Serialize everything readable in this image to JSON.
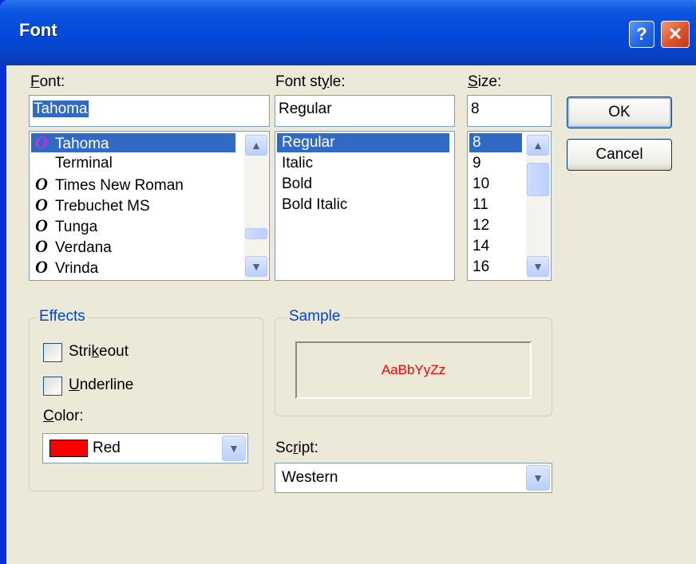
{
  "window": {
    "title": "Font",
    "help_glyph": "?",
    "close_glyph": "✕"
  },
  "font": {
    "label": "Font:",
    "label_mnemonic": "F",
    "label_rest": "ont:",
    "value": "Tahoma",
    "items": [
      {
        "name": "Tahoma",
        "icon": "O",
        "selected": true
      },
      {
        "name": "Terminal",
        "icon": "",
        "selected": false
      },
      {
        "name": "Times New Roman",
        "icon": "O",
        "selected": false
      },
      {
        "name": "Trebuchet MS",
        "icon": "O",
        "selected": false
      },
      {
        "name": "Tunga",
        "icon": "O",
        "selected": false
      },
      {
        "name": "Verdana",
        "icon": "O",
        "selected": false
      },
      {
        "name": "Vrinda",
        "icon": "O",
        "selected": false
      }
    ]
  },
  "style": {
    "label": "Font style:",
    "label_prefix": "Font st",
    "label_mnemonic": "y",
    "label_rest": "le:",
    "value": "Regular",
    "items": [
      "Regular",
      "Italic",
      "Bold",
      "Bold Italic"
    ],
    "selected_index": 0
  },
  "size": {
    "label": "Size:",
    "label_mnemonic": "S",
    "label_rest": "ize:",
    "value": "8",
    "items": [
      "8",
      "9",
      "10",
      "11",
      "12",
      "14",
      "16"
    ],
    "selected_index": 0
  },
  "buttons": {
    "ok": "OK",
    "cancel": "Cancel"
  },
  "effects": {
    "title": "Effects",
    "strikeout": {
      "label": "Strikeout",
      "pre": "Stri",
      "mnemonic": "k",
      "post": "eout",
      "checked": false
    },
    "underline": {
      "label": "Underline",
      "mnemonic": "U",
      "post": "nderline",
      "checked": false
    },
    "color_label": "Color:",
    "color_mnemonic": "C",
    "color_rest": "olor:",
    "color_value": "Red",
    "color_hex": "#ff0000"
  },
  "sample": {
    "title": "Sample",
    "text": "AaBbYyZz",
    "color": "#ff0000"
  },
  "script": {
    "label": "Script:",
    "label_prefix": "Sc",
    "label_mnemonic": "r",
    "label_rest": "ipt:",
    "value": "Western"
  },
  "icons": {
    "scroll_up": "▲",
    "scroll_down": "▼",
    "dropdown": "▼"
  }
}
